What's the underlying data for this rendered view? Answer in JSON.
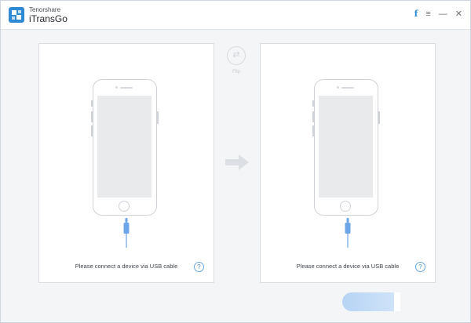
{
  "app": {
    "brand_sub": "Tenorshare",
    "brand_name": "iTransGo"
  },
  "titlebar": {
    "icons": [
      "facebook-icon",
      "menu-icon",
      "minimize-icon",
      "close-icon"
    ],
    "facebook_glyph": "f",
    "menu_glyph": "≡",
    "minimize_glyph": "—",
    "close_glyph": "✕"
  },
  "flip": {
    "label": "Flip",
    "glyph": "⇄"
  },
  "source_panel": {
    "message": "Please connect a device via USB cable",
    "help_glyph": "?"
  },
  "target_panel": {
    "message": "Please connect a device via USB cable",
    "help_glyph": "?"
  },
  "transfer_button": {
    "label": ""
  },
  "colors": {
    "accent": "#2f8ad6",
    "cable": "#6da6e8",
    "button": "#b6d4f4",
    "arrow": "#dcdfe3"
  }
}
